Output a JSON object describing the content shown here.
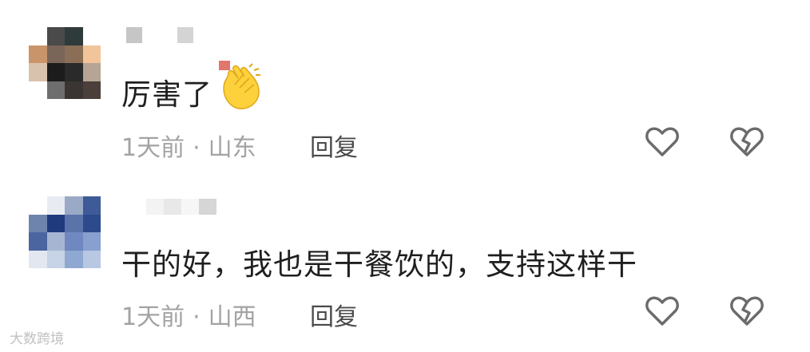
{
  "comments": [
    {
      "text": "厉害了",
      "emoji": "clapping-hands-emoji",
      "time": "1天前",
      "separator": "·",
      "location": "山东",
      "reply_label": "回复",
      "like_icon": "heart-outline-icon",
      "dislike_icon": "broken-heart-icon"
    },
    {
      "text": "干的好，我也是干餐饮的，支持这样干",
      "time": "1天前",
      "separator": "·",
      "location": "山西",
      "reply_label": "回复",
      "like_icon": "heart-outline-icon",
      "dislike_icon": "broken-heart-icon"
    }
  ],
  "watermark": "大数跨境",
  "colors": {
    "text": "#1f1f1f",
    "meta": "#a3a3a3",
    "reply": "#4a4a4a",
    "icon": "#6b6b6b"
  }
}
